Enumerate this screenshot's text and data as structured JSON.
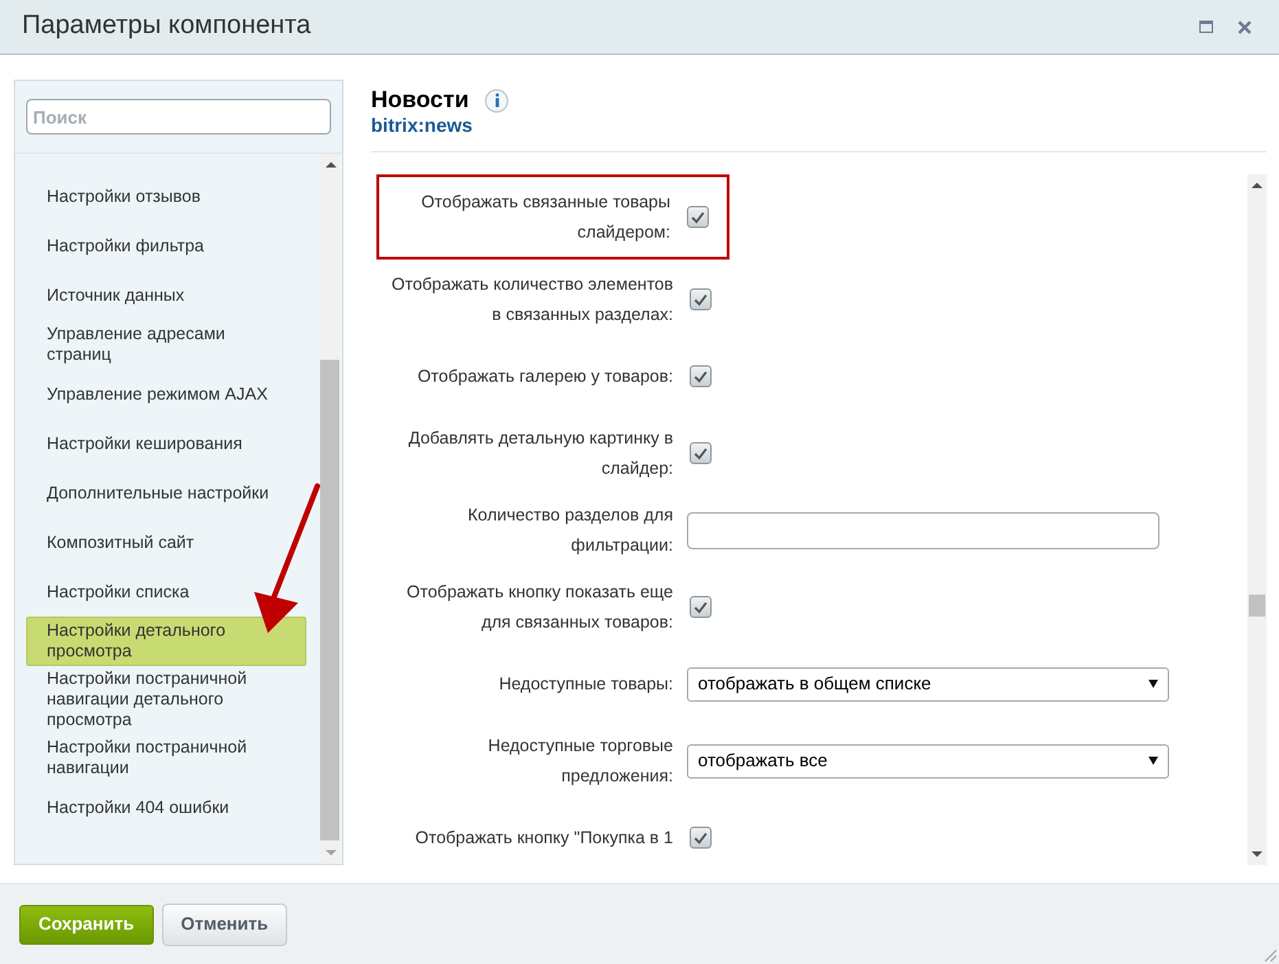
{
  "window": {
    "title": "Параметры компонента"
  },
  "sidebar": {
    "search": {
      "placeholder": "Поиск"
    },
    "items": [
      {
        "label": "Настройки отзывов",
        "selected": false
      },
      {
        "label": "Настройки фильтра",
        "selected": false
      },
      {
        "label": "Источник данных",
        "selected": false
      },
      {
        "label": "Управление адресами страниц",
        "selected": false
      },
      {
        "label": "Управление режимом AJAX",
        "selected": false
      },
      {
        "label": "Настройки кеширования",
        "selected": false
      },
      {
        "label": "Дополнительные настройки",
        "selected": false
      },
      {
        "label": "Композитный сайт",
        "selected": false
      },
      {
        "label": "Настройки списка",
        "selected": false
      },
      {
        "label": "Настройки детального просмотра",
        "selected": true
      },
      {
        "label": "Настройки постраничной навигации детального просмотра",
        "selected": false
      },
      {
        "label": "Настройки постраничной навигации",
        "selected": false
      },
      {
        "label": "Настройки 404 ошибки",
        "selected": false
      }
    ]
  },
  "component": {
    "title": "Новости",
    "code": "bitrix:news"
  },
  "fields": [
    {
      "kind": "checkbox",
      "label": "Отображать связанные товары слайдером:",
      "checked": true,
      "highlighted": true
    },
    {
      "kind": "checkbox",
      "label": "Отображать количество элементов в связанных разделах:",
      "checked": true,
      "highlighted": false
    },
    {
      "kind": "checkbox",
      "label": "Отображать галерею у товаров:",
      "checked": true,
      "highlighted": false
    },
    {
      "kind": "checkbox",
      "label": "Добавлять детальную картинку в слайдер:",
      "checked": true,
      "highlighted": false
    },
    {
      "kind": "text",
      "label": "Количество разделов для фильтрации:",
      "highlighted": false
    },
    {
      "kind": "checkbox",
      "label": "Отображать кнопку показать еще для связанных товаров:",
      "checked": true,
      "highlighted": false
    },
    {
      "kind": "select",
      "label": "Недоступные товары:",
      "value": "отображать в общем списке",
      "highlighted": false
    },
    {
      "kind": "select",
      "label": "Недоступные торговые предложения:",
      "value": "отображать все",
      "highlighted": false
    },
    {
      "kind": "checkbox",
      "label": "Отображать кнопку \"Покупка в 1",
      "checked": true,
      "highlighted": false
    }
  ],
  "buttons": [
    {
      "label": "Сохранить",
      "kind": "primary"
    },
    {
      "label": "Отменить",
      "kind": "secondary"
    }
  ]
}
